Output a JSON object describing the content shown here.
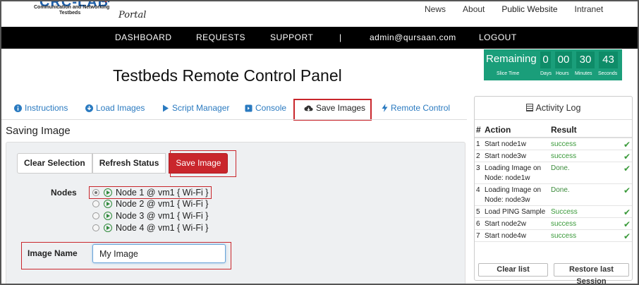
{
  "logo": {
    "title": "CRC-LAB",
    "line1": "Communication and Networking",
    "line2": "Testbeds",
    "portal": "Portal"
  },
  "top_links": [
    "News",
    "About",
    "Public Website",
    "Intranet"
  ],
  "nav": {
    "dashboard": "DASHBOARD",
    "requests": "REQUESTS",
    "support": "SUPPORT",
    "sep": "|",
    "user": "admin@qursaan.com",
    "logout": "LOGOUT"
  },
  "timer": {
    "label": "Remaining",
    "days": "0",
    "hours": "00",
    "minutes": "30",
    "seconds": "43",
    "caption_slice": "Slice Time",
    "caption_days": "Days",
    "caption_hours": "Hours",
    "caption_minutes": "Minutes",
    "caption_seconds": "Seconds"
  },
  "page_title": "Testbeds Remote Control Panel",
  "tabs": [
    {
      "label": "Instructions",
      "icon": "info-icon"
    },
    {
      "label": "Load Images",
      "icon": "download-icon"
    },
    {
      "label": "Script Manager",
      "icon": "play-icon"
    },
    {
      "label": "Console",
      "icon": "console-icon"
    },
    {
      "label": "Save Images",
      "icon": "cloud-download-icon"
    },
    {
      "label": "Remote Control",
      "icon": "lightning-icon"
    }
  ],
  "section_title": "Saving Image",
  "buttons": {
    "clear": "Clear Selection",
    "refresh": "Refresh Status",
    "save": "Save Image"
  },
  "nodes_label": "Nodes",
  "nodes": [
    "Node 1 @ vm1 { Wi-Fi }",
    "Node 2 @ vm1 { Wi-Fi }",
    "Node 3 @ vm1 { Wi-Fi }",
    "Node 4 @ vm1 { Wi-Fi }"
  ],
  "selected_node": 0,
  "image_name": {
    "label": "Image Name",
    "value": "My Image"
  },
  "log": {
    "title": "Activity Log",
    "headers": {
      "num": "#",
      "action": "Action",
      "result": "Result"
    },
    "rows": [
      {
        "n": "1",
        "action": "Start node1w",
        "result": "success"
      },
      {
        "n": "2",
        "action": "Start node3w",
        "result": "success"
      },
      {
        "n": "3",
        "action": "Loading Image on Node: node1w",
        "result": "Done."
      },
      {
        "n": "4",
        "action": "Loading Image on Node: node3w",
        "result": "Done."
      },
      {
        "n": "5",
        "action": "Load PING Sample",
        "result": "Success"
      },
      {
        "n": "6",
        "action": "Start node2w",
        "result": "success"
      },
      {
        "n": "7",
        "action": "Start node4w",
        "result": "success"
      }
    ],
    "clear_btn": "Clear list",
    "restore_btn": "Restore last Session"
  },
  "colors": {
    "accent_red": "#c9262c",
    "timer_green": "#1a9e7a",
    "link_blue": "#2a7ac0"
  }
}
